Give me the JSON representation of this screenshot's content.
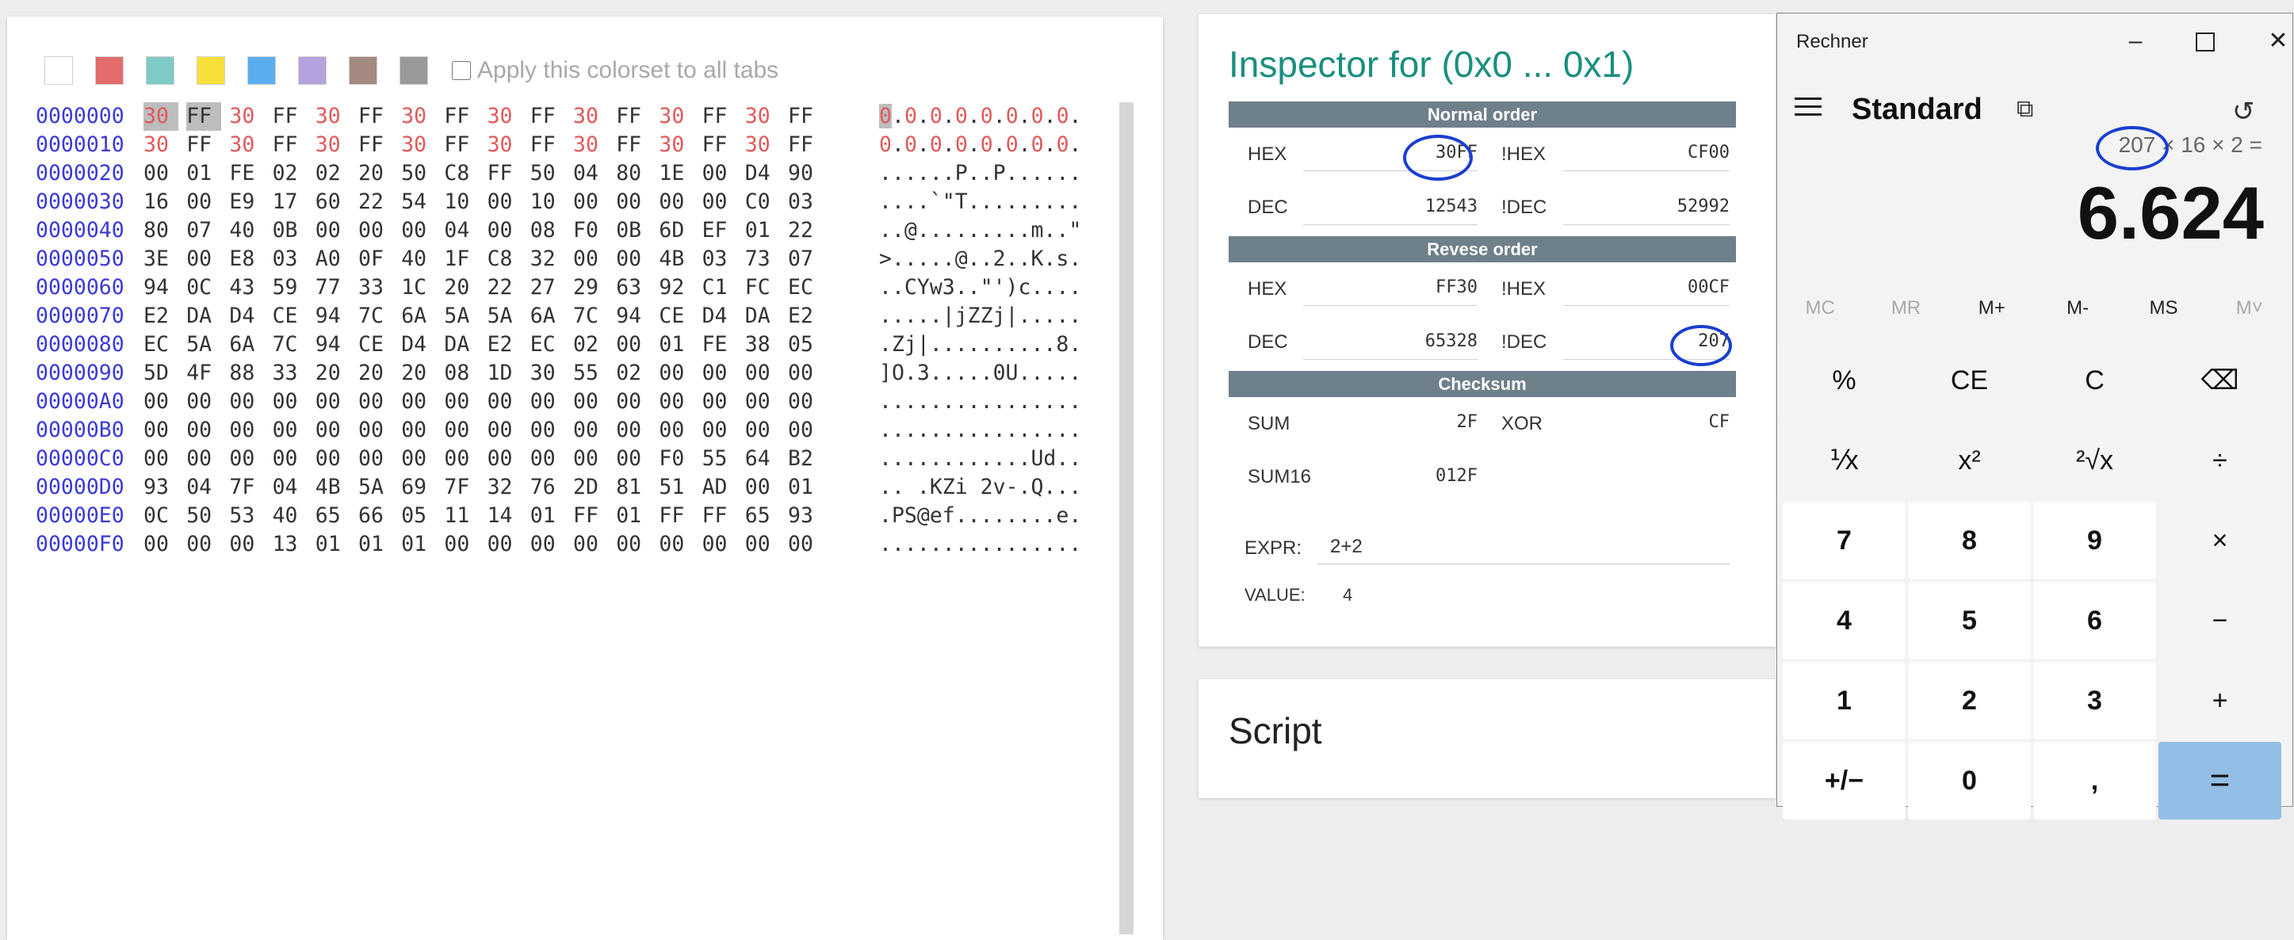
{
  "hex_editor": {
    "swatches": [
      "#ffffff",
      "#e36b6b",
      "#7ecbc6",
      "#f8e03a",
      "#5aaeef",
      "#b4a2de",
      "#a28a80",
      "#9a9a9a"
    ],
    "apply_label": "Apply this colorset to all tabs",
    "rows": [
      {
        "addr": "0000000",
        "bytes": [
          "30",
          "FF",
          "30",
          "FF",
          "30",
          "FF",
          "30",
          "FF",
          "30",
          "FF",
          "30",
          "FF",
          "30",
          "FF",
          "30",
          "FF"
        ],
        "ascii": "0.0.0.0.0.0.0.0."
      },
      {
        "addr": "0000010",
        "bytes": [
          "30",
          "FF",
          "30",
          "FF",
          "30",
          "FF",
          "30",
          "FF",
          "30",
          "FF",
          "30",
          "FF",
          "30",
          "FF",
          "30",
          "FF"
        ],
        "ascii": "0.0.0.0.0.0.0.0."
      },
      {
        "addr": "0000020",
        "bytes": [
          "00",
          "01",
          "FE",
          "02",
          "02",
          "20",
          "50",
          "C8",
          "FF",
          "50",
          "04",
          "80",
          "1E",
          "00",
          "D4",
          "90"
        ],
        "ascii": "......P..P......"
      },
      {
        "addr": "0000030",
        "bytes": [
          "16",
          "00",
          "E9",
          "17",
          "60",
          "22",
          "54",
          "10",
          "00",
          "10",
          "00",
          "00",
          "00",
          "00",
          "C0",
          "03"
        ],
        "ascii": "....`\"T........."
      },
      {
        "addr": "0000040",
        "bytes": [
          "80",
          "07",
          "40",
          "0B",
          "00",
          "00",
          "00",
          "04",
          "00",
          "08",
          "F0",
          "0B",
          "6D",
          "EF",
          "01",
          "22"
        ],
        "ascii": "..@.........m..\""
      },
      {
        "addr": "0000050",
        "bytes": [
          "3E",
          "00",
          "E8",
          "03",
          "A0",
          "0F",
          "40",
          "1F",
          "C8",
          "32",
          "00",
          "00",
          "4B",
          "03",
          "73",
          "07"
        ],
        "ascii": ">.....@..2..K.s."
      },
      {
        "addr": "0000060",
        "bytes": [
          "94",
          "0C",
          "43",
          "59",
          "77",
          "33",
          "1C",
          "20",
          "22",
          "27",
          "29",
          "63",
          "92",
          "C1",
          "FC",
          "EC"
        ],
        "ascii": "..CYw3..\"')c...."
      },
      {
        "addr": "0000070",
        "bytes": [
          "E2",
          "DA",
          "D4",
          "CE",
          "94",
          "7C",
          "6A",
          "5A",
          "5A",
          "6A",
          "7C",
          "94",
          "CE",
          "D4",
          "DA",
          "E2"
        ],
        "ascii": ".....|jZZj|....."
      },
      {
        "addr": "0000080",
        "bytes": [
          "EC",
          "5A",
          "6A",
          "7C",
          "94",
          "CE",
          "D4",
          "DA",
          "E2",
          "EC",
          "02",
          "00",
          "01",
          "FE",
          "38",
          "05"
        ],
        "ascii": ".Zj|..........8."
      },
      {
        "addr": "0000090",
        "bytes": [
          "5D",
          "4F",
          "88",
          "33",
          "20",
          "20",
          "20",
          "08",
          "1D",
          "30",
          "55",
          "02",
          "00",
          "00",
          "00",
          "00"
        ],
        "ascii": "]O.3.....0U....."
      },
      {
        "addr": "00000A0",
        "bytes": [
          "00",
          "00",
          "00",
          "00",
          "00",
          "00",
          "00",
          "00",
          "00",
          "00",
          "00",
          "00",
          "00",
          "00",
          "00",
          "00"
        ],
        "ascii": "................"
      },
      {
        "addr": "00000B0",
        "bytes": [
          "00",
          "00",
          "00",
          "00",
          "00",
          "00",
          "00",
          "00",
          "00",
          "00",
          "00",
          "00",
          "00",
          "00",
          "00",
          "00"
        ],
        "ascii": "................"
      },
      {
        "addr": "00000C0",
        "bytes": [
          "00",
          "00",
          "00",
          "00",
          "00",
          "00",
          "00",
          "00",
          "00",
          "00",
          "00",
          "00",
          "F0",
          "55",
          "64",
          "B2"
        ],
        "ascii": "............Ud.."
      },
      {
        "addr": "00000D0",
        "bytes": [
          "93",
          "04",
          "7F",
          "04",
          "4B",
          "5A",
          "69",
          "7F",
          "32",
          "76",
          "2D",
          "81",
          "51",
          "AD",
          "00",
          "01"
        ],
        "ascii": ".. .KZi 2v-.Q..."
      },
      {
        "addr": "00000E0",
        "bytes": [
          "0C",
          "50",
          "53",
          "40",
          "65",
          "66",
          "05",
          "11",
          "14",
          "01",
          "FF",
          "01",
          "FF",
          "FF",
          "65",
          "93"
        ],
        "ascii": ".PS@ef........e."
      },
      {
        "addr": "00000F0",
        "bytes": [
          "00",
          "00",
          "00",
          "13",
          "01",
          "01",
          "01",
          "00",
          "00",
          "00",
          "00",
          "00",
          "00",
          "00",
          "00",
          "00"
        ],
        "ascii": "................"
      }
    ]
  },
  "inspector": {
    "title": "Inspector for (0x0 ... 0x1)",
    "normal_order": {
      "header": "Normal order",
      "hex_label": "HEX",
      "hex": "30FF",
      "nhex_label": "!HEX",
      "nhex": "CF00",
      "dec_label": "DEC",
      "dec": "12543",
      "ndec_label": "!DEC",
      "ndec": "52992"
    },
    "reverse_order": {
      "header": "Revese order",
      "hex_label": "HEX",
      "hex": "FF30",
      "nhex_label": "!HEX",
      "nhex": "00CF",
      "dec_label": "DEC",
      "dec": "65328",
      "ndec_label": "!DEC",
      "ndec": "207"
    },
    "checksum": {
      "header": "Checksum",
      "sum_label": "SUM",
      "sum": "2F",
      "xor_label": "XOR",
      "xor": "CF",
      "sum16_label": "SUM16",
      "sum16": "012F"
    },
    "expr_label": "EXPR:",
    "expr_value": "2+2",
    "value_label": "VALUE:",
    "value": "4",
    "annotation_color": "#1a3fd0"
  },
  "script": {
    "title": "Script"
  },
  "calculator": {
    "app_title": "Rechner",
    "mode": "Standard",
    "expression": "207 × 16 × 2 =",
    "result": "6.624",
    "memory": [
      "MC",
      "MR",
      "M+",
      "M-",
      "MS",
      "M˅"
    ],
    "keys": [
      "%",
      "CE",
      "C",
      "⌫",
      "⅟x",
      "x²",
      "²√x",
      "÷",
      "7",
      "8",
      "9",
      "×",
      "4",
      "5",
      "6",
      "−",
      "1",
      "2",
      "3",
      "+",
      "+/−",
      "0",
      ",",
      "="
    ],
    "accent": "#93bfe6"
  }
}
